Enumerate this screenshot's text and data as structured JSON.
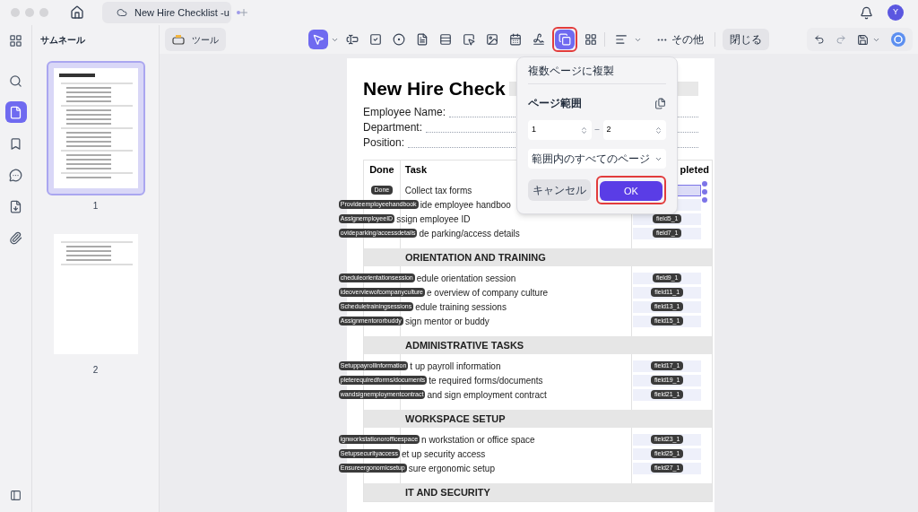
{
  "title_bar": {
    "tab_title": "New Hire Checklist -u",
    "avatar": "Y"
  },
  "sidebar": {
    "items": [
      {
        "selected": false
      },
      {
        "selected": true
      },
      {
        "selected": false
      },
      {
        "selected": false
      },
      {
        "selected": false
      },
      {
        "selected": false
      }
    ]
  },
  "thumbnails": {
    "title": "サムネール",
    "pages": [
      {
        "label": "1",
        "selected": true,
        "kind": "first"
      },
      {
        "label": "2",
        "selected": false,
        "kind": "second"
      }
    ]
  },
  "toolbar": {
    "tools_button": "ツール",
    "tools": [
      {
        "kind": "pointer",
        "selected": true,
        "annotated": false
      },
      {
        "kind": "text_field",
        "selected": false,
        "annotated": false
      },
      {
        "kind": "checkbox",
        "selected": false,
        "annotated": false
      },
      {
        "kind": "radio",
        "selected": false,
        "annotated": false
      },
      {
        "kind": "combo_box",
        "selected": false,
        "annotated": false
      },
      {
        "kind": "list_box",
        "selected": false,
        "annotated": false
      },
      {
        "kind": "button",
        "selected": false,
        "annotated": false
      },
      {
        "kind": "image",
        "selected": false,
        "annotated": false
      },
      {
        "kind": "date",
        "selected": false,
        "annotated": false
      },
      {
        "kind": "signature",
        "selected": false,
        "annotated": false
      },
      {
        "kind": "copy_pages",
        "selected": true,
        "annotated": true
      },
      {
        "kind": "grid",
        "selected": false,
        "annotated": false
      },
      {
        "kind": "align",
        "selected": false,
        "annotated": false
      }
    ],
    "more": "その他",
    "close": "閉じる"
  },
  "document": {
    "title": "New Hire Check",
    "info": [
      "Employee Name:",
      "Department:",
      "Position:"
    ],
    "columns": [
      "Done",
      "Task",
      "pleted"
    ],
    "sections": [
      {
        "rows": [
          {
            "done_tag": "Done",
            "task": "Collect tax forms",
            "selected": true
          },
          {
            "tag": "Provideemployeehandbook",
            "task": "ide employee handboo",
            "selected": false
          },
          {
            "tag": "AssignemployeeID",
            "task": "ssign employee ID",
            "field": "field5_1",
            "selected": false
          },
          {
            "tag": "ovideparking/accessdetails",
            "task": "de parking/access details",
            "field": "field7_1",
            "selected": false
          }
        ]
      },
      {
        "heading": "ORIENTATION AND TRAINING",
        "rows": [
          {
            "tag": "cheduleorientationsession",
            "task": "edule orientation session",
            "field": "field9_1",
            "selected": false
          },
          {
            "tag": "ideoverviewofcompanyculture",
            "task": "e overview of company culture",
            "field": "field11_1",
            "selected": false
          },
          {
            "tag": "Scheduletrainingsessions",
            "task": "edule training sessions",
            "field": "field13_1",
            "selected": false
          },
          {
            "tag": "Assignmentororbuddy",
            "task": "sign mentor or buddy",
            "field": "field15_1",
            "selected": false
          }
        ]
      },
      {
        "heading": "ADMINISTRATIVE TASKS",
        "rows": [
          {
            "tag": "Setuppayrollinformation",
            "task": "t up payroll information",
            "field": "field17_1",
            "selected": false
          },
          {
            "tag": "pleterequiredforms/documents",
            "task": "te required forms/documents",
            "field": "field19_1",
            "selected": false
          },
          {
            "tag": "wandsignemploymentcontract",
            "task": "and sign employment contract",
            "field": "field21_1",
            "selected": false
          }
        ]
      },
      {
        "heading": "WORKSPACE SETUP",
        "rows": [
          {
            "tag": "ignworkstationorofficespace",
            "task": "n workstation or office space",
            "field": "field23_1",
            "selected": false
          },
          {
            "tag": "Setupsecurityaccess",
            "task": "et up security access",
            "field": "field25_1",
            "selected": false
          },
          {
            "tag": "Ensureergonomicsetup",
            "task": "sure ergonomic setup",
            "field": "field27_1",
            "selected": false
          }
        ]
      },
      {
        "heading": "IT AND SECURITY"
      }
    ]
  },
  "dialog": {
    "title": "複数ページに複製",
    "range_label": "ページ範囲",
    "from": "1",
    "separator": "–",
    "to": "2",
    "scope": "範囲内のすべてのページ",
    "cancel": "キャンセル",
    "ok": "OK",
    "ok_annotated": true
  }
}
